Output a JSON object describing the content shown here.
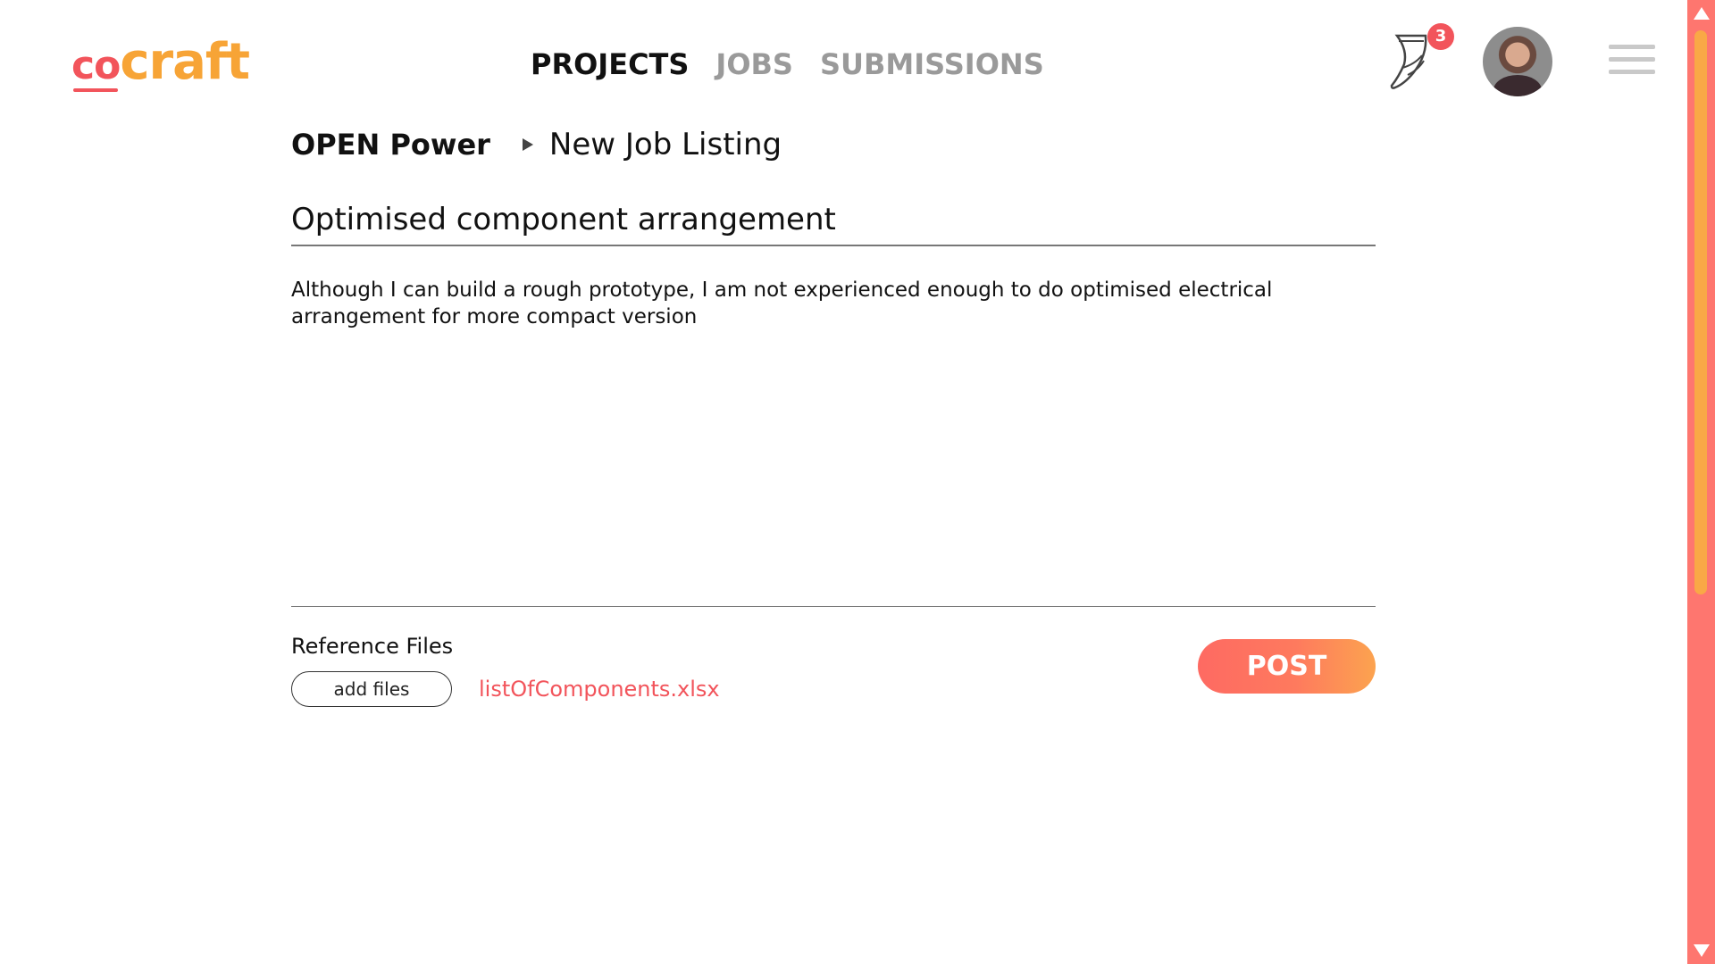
{
  "header": {
    "logo": {
      "part1": "co",
      "part2": "craft"
    },
    "nav": [
      {
        "label": "PROJECTS",
        "active": true
      },
      {
        "label": "JOBS",
        "active": false
      },
      {
        "label": "SUBMISSIONS",
        "active": false
      }
    ],
    "notifications": {
      "icon": "horn-notification-icon",
      "count": "3"
    },
    "avatar": "avatar",
    "menu_icon": "hamburger-menu-icon"
  },
  "breadcrumb": {
    "project": "OPEN Power",
    "separator_icon": "triangle-right-icon",
    "page": "New Job Listing"
  },
  "form": {
    "title_value": "Optimised component arrangement",
    "description_value": "Although I can build a rough prototype, I am not experienced enough to do optimised electrical arrangement for more compact version",
    "reference_files_label": "Reference Files",
    "add_files_label": "add files",
    "files": [
      "listOfComponents.xlsx"
    ],
    "post_label": "POST"
  },
  "colors": {
    "brand_red": "#f2545b",
    "brand_orange": "#f7a436",
    "scrollbar": "#fe766f",
    "scroll_thumb": "#f9a846"
  }
}
